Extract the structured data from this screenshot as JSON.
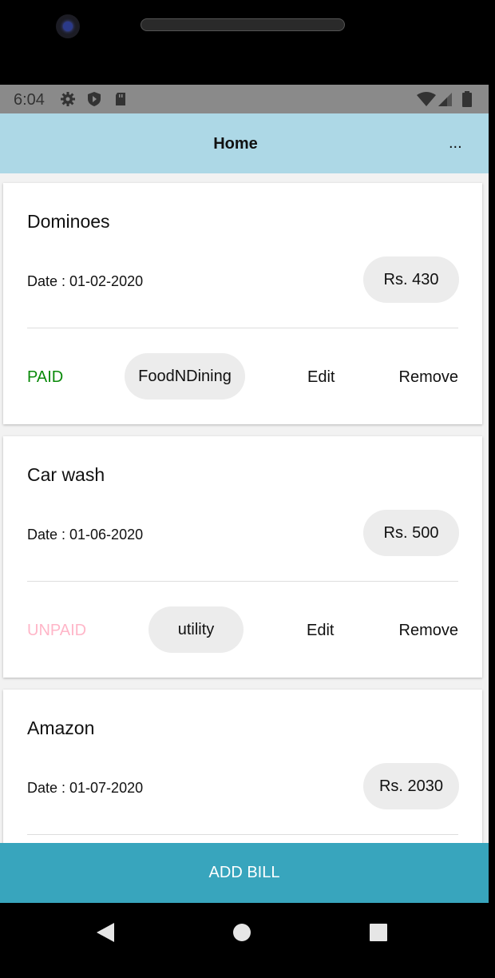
{
  "status_bar": {
    "time": "6:04",
    "icons_left": [
      "gear-icon",
      "shield-icon",
      "sd-card-icon"
    ],
    "icons_right": [
      "wifi-icon",
      "signal-icon",
      "battery-icon"
    ]
  },
  "app_bar": {
    "title": "Home",
    "menu_label": "..."
  },
  "bills": [
    {
      "name": "Dominoes",
      "date": "Date : 01-02-2020",
      "amount": "Rs. 430",
      "status": "PAID",
      "category": "FoodNDining",
      "edit_label": "Edit",
      "remove_label": "Remove"
    },
    {
      "name": "Car wash",
      "date": "Date : 01-06-2020",
      "amount": "Rs. 500",
      "status": "UNPAID",
      "category": "utility",
      "edit_label": "Edit",
      "remove_label": "Remove"
    },
    {
      "name": "Amazon",
      "date": "Date : 01-07-2020",
      "amount": "Rs. 2030"
    }
  ],
  "add_bill_label": "ADD BILL",
  "colors": {
    "app_bar": "#add8e6",
    "add_bill": "#38a5bd",
    "paid": "#0a8a0a",
    "unpaid": "#ffb6c8",
    "chip": "#ececec"
  },
  "nav_bar": [
    "back-icon",
    "home-icon",
    "recents-icon"
  ]
}
